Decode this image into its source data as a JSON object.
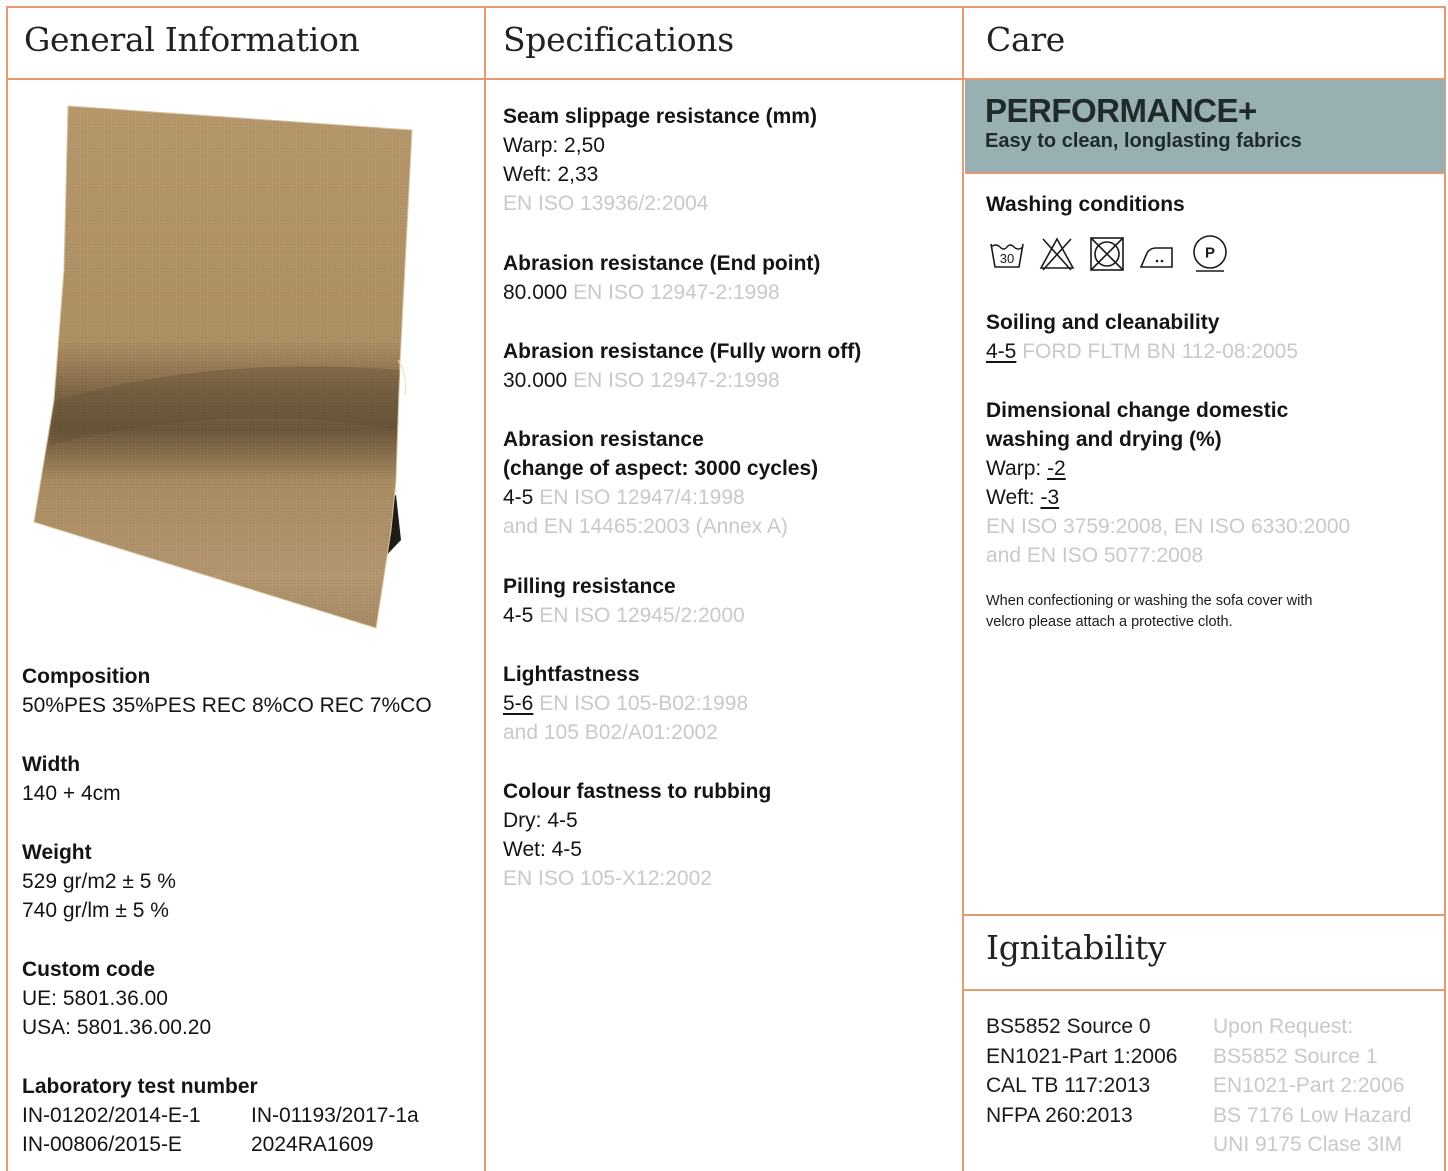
{
  "columns": {
    "general": "General Information",
    "specs": "Specifications",
    "care": "Care",
    "ignitability": "Ignitability"
  },
  "general": {
    "composition_label": "Composition",
    "composition_value": "50%PES 35%PES REC 8%CO REC 7%CO",
    "width_label": "Width",
    "width_value": "140 + 4cm",
    "weight_label": "Weight",
    "weight_values": [
      "529 gr/m2 ± 5 %",
      "740 gr/lm ± 5 %"
    ],
    "custom_label": "Custom code",
    "custom_values": [
      "UE: 5801.36.00",
      "USA: 5801.36.00.20"
    ],
    "lab_label": "Laboratory test number",
    "lab_numbers": [
      "IN-01202/2014-E-1",
      "IN-01193/2017-1a",
      "IN-00806/2015-E",
      "2024RA1609"
    ],
    "swatch_color": "#b89a6e"
  },
  "specs": {
    "seam_label": "Seam slippage resistance (mm)",
    "seam_warp": "Warp: 2,50",
    "seam_weft": "Weft: 2,33",
    "seam_std": "EN ISO 13936/2:2004",
    "abr_end_label": "Abrasion resistance (End point)",
    "abr_end_value": "80.000",
    "abr_end_std": "EN ISO 12947-2:1998",
    "abr_worn_label": "Abrasion resistance (Fully worn off)",
    "abr_worn_value": "30.000",
    "abr_worn_std": "EN ISO 12947-2:1998",
    "abr_aspect_label_1": "Abrasion resistance",
    "abr_aspect_label_2": "(change of aspect: 3000 cycles)",
    "abr_aspect_value": "4-5",
    "abr_aspect_std_1": "EN ISO 12947/4:1998",
    "abr_aspect_std_2": "and EN 14465:2003 (Annex A)",
    "pilling_label": "Pilling resistance",
    "pilling_value": "4-5",
    "pilling_std": "EN ISO 12945/2:2000",
    "light_label": "Lightfastness",
    "light_value": "5-6",
    "light_std_1": "EN ISO 105-B02:1998",
    "light_std_2": "and 105 B02/A01:2002",
    "rub_label": "Colour fastness to rubbing",
    "rub_dry": "Dry: 4-5",
    "rub_wet": "Wet: 4-5",
    "rub_std": "EN ISO 105-X12:2002"
  },
  "care": {
    "perf_title": "PERFORMANCE+",
    "perf_sub": "Easy to clean, longlasting fabrics",
    "banner_color": "#99b0b2",
    "wash_label": "Washing conditions",
    "icons": [
      "wash-30-icon",
      "no-bleach-icon",
      "no-tumble-dry-icon",
      "iron-low-icon",
      "dry-clean-p-icon"
    ],
    "wash_temp": "30",
    "dry_clean_letter": "P",
    "soil_label": "Soiling and cleanability",
    "soil_value": "4-5",
    "soil_std": "FORD FLTM BN 112-08:2005",
    "dim_label_1": "Dimensional change domestic",
    "dim_label_2": "washing and drying (%)",
    "dim_warp_prefix": "Warp: ",
    "dim_warp": "-2",
    "dim_weft_prefix": "Weft: ",
    "dim_weft": "-3",
    "dim_std_1": "EN ISO 3759:2008, EN ISO 6330:2000",
    "dim_std_2": "and EN ISO 5077:2008",
    "note_1": "When confectioning or washing the sofa cover with",
    "note_2": "velcro please attach a protective cloth."
  },
  "ignitability": {
    "passed": [
      "BS5852 Source 0",
      "EN1021-Part 1:2006",
      "CAL TB 117:2013",
      "NFPA 260:2013"
    ],
    "on_request": [
      "Upon Request:",
      "BS5852 Source 1",
      "EN1021-Part 2:2006",
      "BS 7176 Low Hazard",
      "UNI 9175 Clase 3IM"
    ]
  },
  "colors": {
    "divider": "#e79a72",
    "muted_text": "#c9c9c9"
  }
}
